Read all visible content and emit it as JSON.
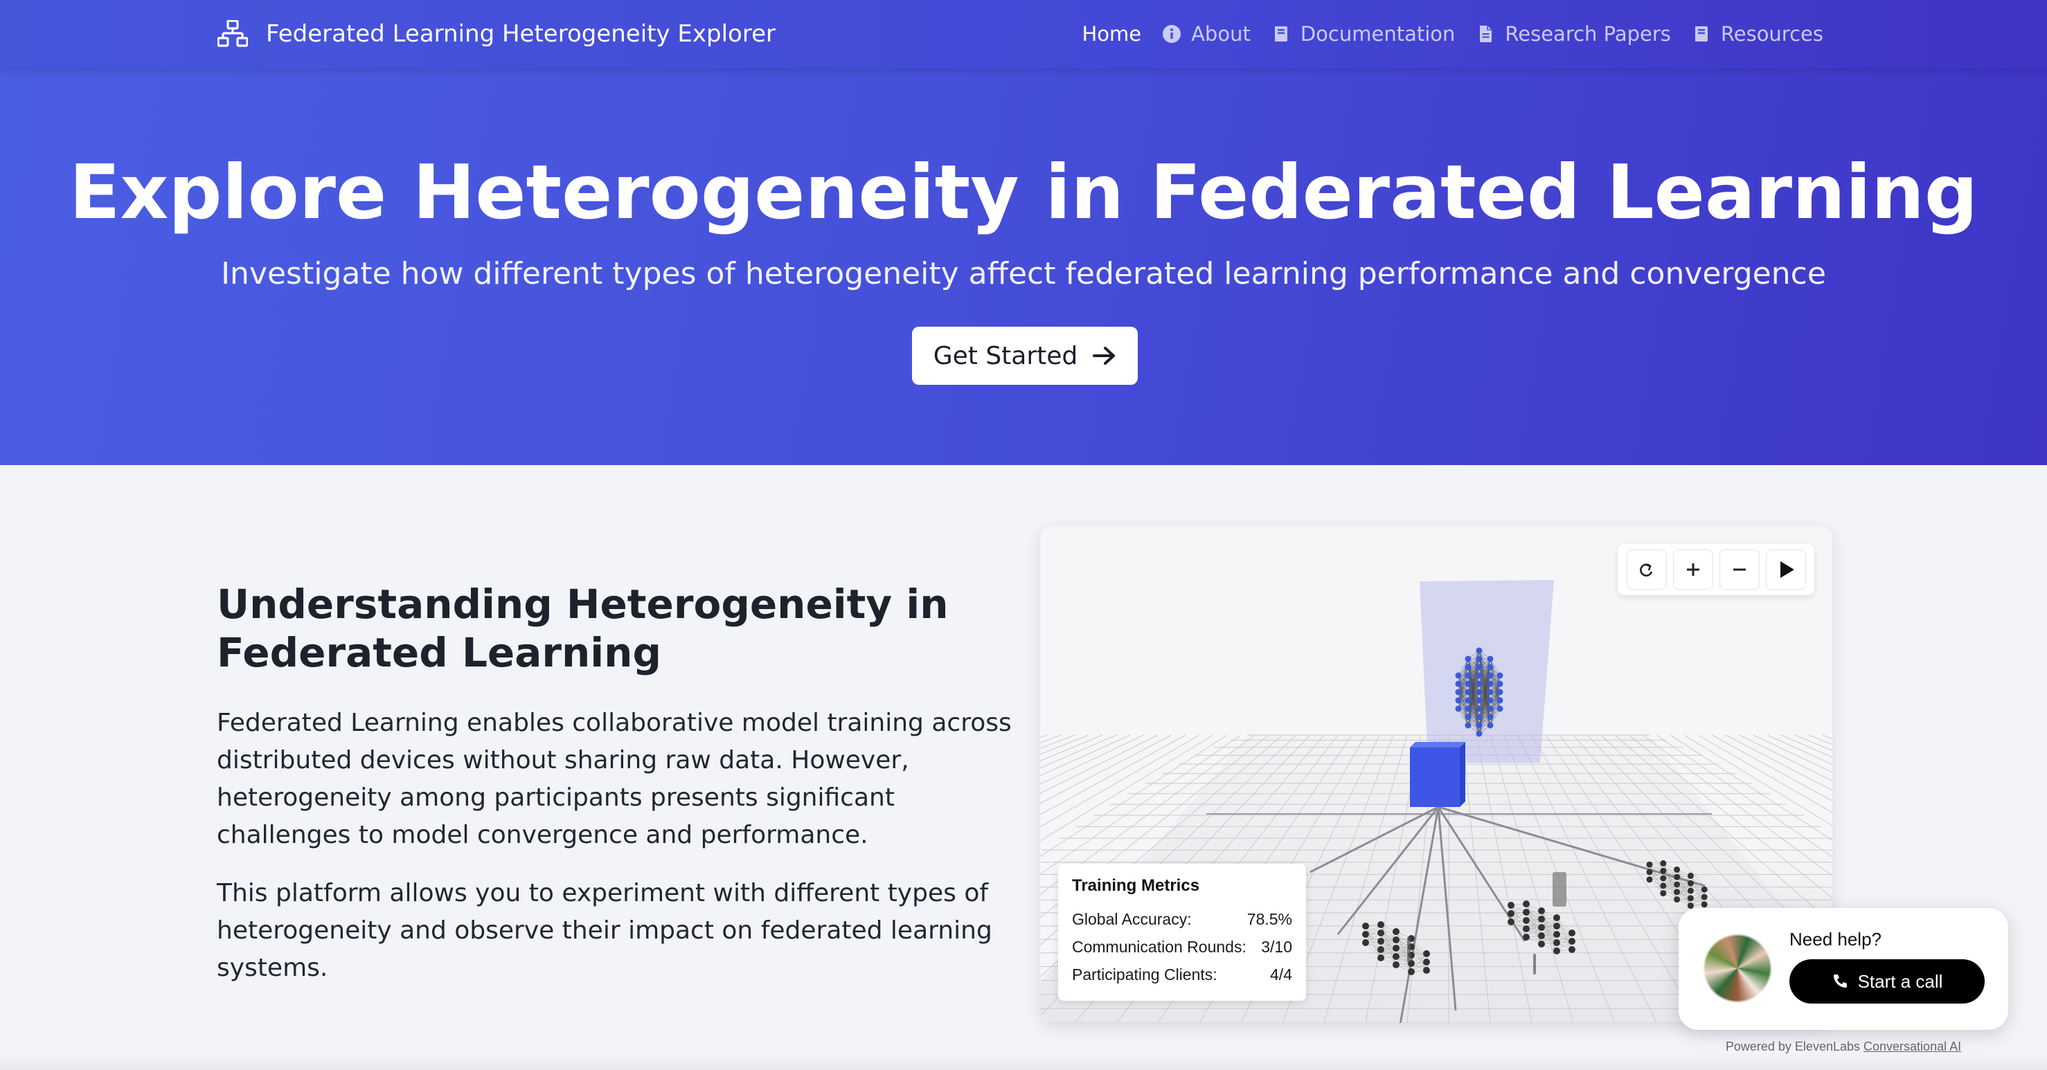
{
  "nav": {
    "brand": "Federated Learning Heterogeneity Explorer",
    "brand_icon": "sitemap-icon",
    "links": [
      {
        "label": "Home",
        "icon": "",
        "active": true
      },
      {
        "label": "About",
        "icon": "info-circle-icon"
      },
      {
        "label": "Documentation",
        "icon": "book-icon"
      },
      {
        "label": "Research Papers",
        "icon": "file-icon"
      },
      {
        "label": "Resources",
        "icon": "book-icon"
      }
    ]
  },
  "hero": {
    "title": "Explore Heterogeneity in Federated Learning",
    "subtitle": "Investigate how different types of heterogeneity affect federated learning performance and convergence",
    "cta_label": "Get Started",
    "cta_icon": "arrow-right-icon"
  },
  "content": {
    "heading": "Understanding Heterogeneity in Federated Learning",
    "paragraph1": "Federated Learning enables collaborative model training across distributed devices without sharing raw data. However, heterogeneity among participants presents significant challenges to model convergence and performance.",
    "paragraph2": "This platform allows you to experiment with different types of heterogeneity and observe their impact on federated learning systems."
  },
  "viewer": {
    "controls": [
      {
        "name": "reset-view-button",
        "icon": "reset-icon"
      },
      {
        "name": "zoom-in-button",
        "icon": "plus-icon"
      },
      {
        "name": "zoom-out-button",
        "icon": "minus-icon"
      },
      {
        "name": "play-button",
        "icon": "play-icon"
      }
    ],
    "metrics": {
      "title": "Training Metrics",
      "rows": [
        {
          "label": "Global Accuracy:",
          "value": "78.5%"
        },
        {
          "label": "Communication Rounds:",
          "value": "3/10"
        },
        {
          "label": "Participating Clients:",
          "value": "4/4"
        }
      ]
    },
    "colors": {
      "server_cube": "#3d56e6",
      "neuron": "#3b5bd9",
      "client_neuron": "#333333"
    }
  },
  "help_widget": {
    "prompt": "Need help?",
    "button_label": "Start a call",
    "button_icon": "phone-icon",
    "powered_prefix": "Powered by ElevenLabs",
    "powered_link": "Conversational AI"
  },
  "colors": {
    "accent": "#4650d9",
    "hero_start": "#4a5ee3",
    "hero_end": "#3e35c6"
  }
}
